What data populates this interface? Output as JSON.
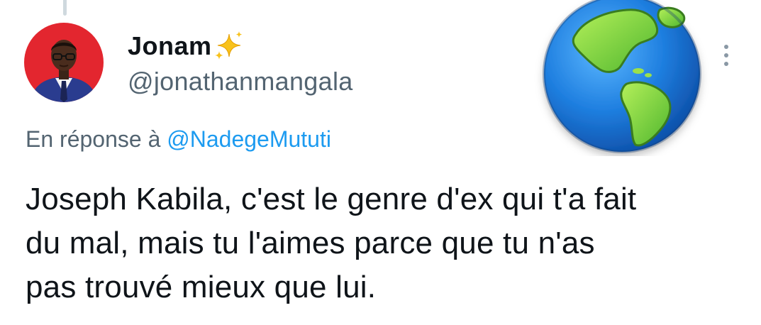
{
  "tweet": {
    "display_name": "Jonam",
    "display_name_emoji": "sparkles-icon",
    "handle": "@jonathanmangala",
    "reply_prefix": "En réponse à",
    "reply_to": "@NadegeMututi",
    "text_lines": [
      "Joseph Kabila, c'est le genre d'ex qui t'a fait",
      "du mal, mais tu l'aimes parce que tu n'as",
      "pas trouvé mieux que lui."
    ]
  },
  "icons": {
    "avatar": "user-avatar",
    "globe": "globe-americas-icon",
    "more": "more-vertical-icon"
  },
  "colors": {
    "text": "#0f1419",
    "muted": "#536471",
    "link": "#1d9bf0",
    "avatar_bg": "#e3262f"
  }
}
